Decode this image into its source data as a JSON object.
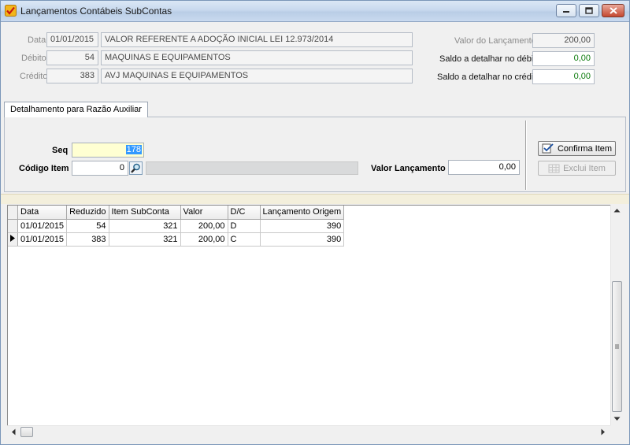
{
  "window": {
    "title": "Lançamentos Contábeis SubContas",
    "icons": {
      "app": "check-app-icon",
      "minimize": "minimize-icon",
      "maximize": "maximize-icon",
      "close": "close-icon"
    }
  },
  "header": {
    "data_label": "Data",
    "data_value": "01/01/2015",
    "historico": "VALOR REFERENTE A ADOÇÃO INICIAL LEI 12.973/2014",
    "debito_label": "Débito",
    "debito_code": "54",
    "debito_desc": "MAQUINAS E EQUIPAMENTOS",
    "credito_label": "Crédito",
    "credito_code": "383",
    "credito_desc": "AVJ MAQUINAS E EQUIPAMENTOS",
    "valor_label": "Valor do Lançamento",
    "valor_value": "200,00",
    "saldo_debito_label": "Saldo a detalhar no débito",
    "saldo_debito_value": "0,00",
    "saldo_credito_label": "Saldo a detalhar no crédito",
    "saldo_credito_value": "0,00"
  },
  "tab": {
    "label": "Detalhamento para Razão Auxiliar"
  },
  "detail": {
    "seq_label": "Seq",
    "seq_value": "178",
    "item_label": "Código Item",
    "item_value": "0",
    "item_description": "",
    "valor_label": "Valor Lançamento",
    "valor_value": "0,00",
    "confirm_label": "Confirma Item",
    "exclude_label": "Exclui Item"
  },
  "colors": {
    "accent": "#3399ff",
    "saldo_green": "#0b7a0b",
    "seq_bg": "#ffffd2"
  },
  "grid": {
    "columns": [
      "Data",
      "Reduzido",
      "Item SubConta",
      "Valor",
      "D/C",
      "Lançamento Origem"
    ],
    "rows": [
      {
        "data": "01/01/2015",
        "reduzido": "54",
        "item": "321",
        "valor": "200,00",
        "dc": "D",
        "origem": "390"
      },
      {
        "data": "01/01/2015",
        "reduzido": "383",
        "item": "321",
        "valor": "200,00",
        "dc": "C",
        "origem": "390"
      }
    ]
  }
}
